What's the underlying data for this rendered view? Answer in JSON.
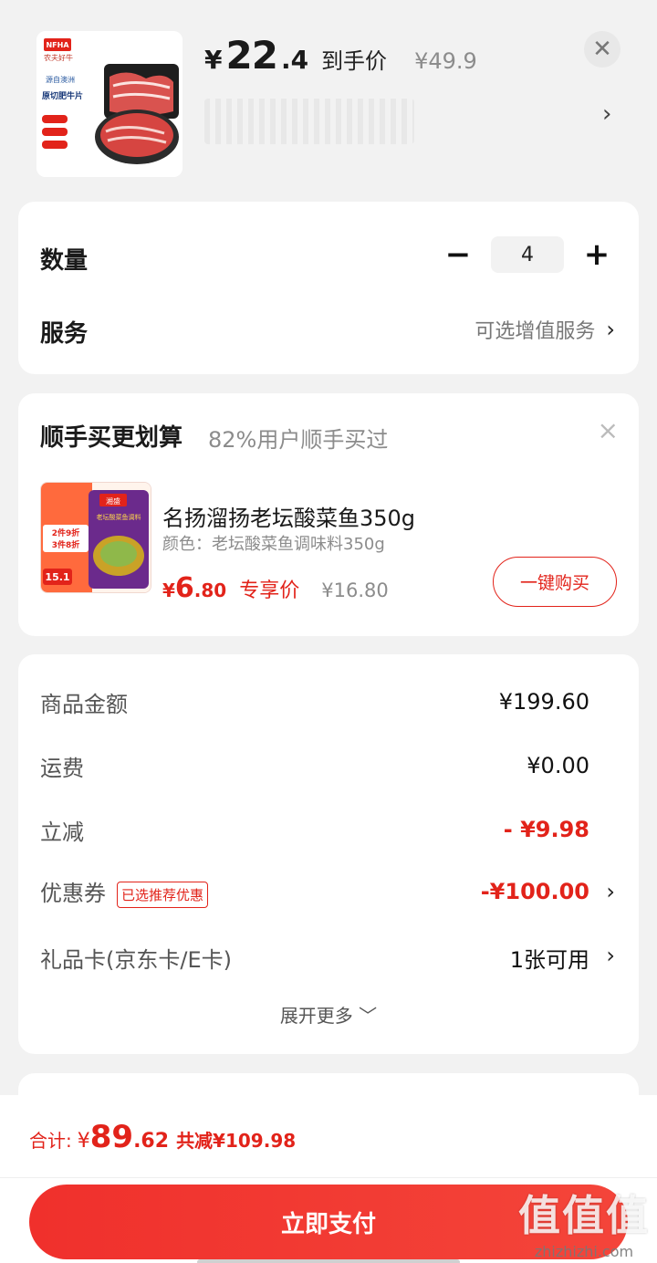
{
  "product": {
    "brand_logo_text": "NFHA",
    "brand_name": "农夫好牛",
    "badge_origin": "源自澳洲",
    "badge_title": "原切肥牛片",
    "price_currency": "¥",
    "price_integer": "22",
    "price_decimal": ".4",
    "price_label": "到手价",
    "original_price": "¥49.9",
    "close_icon": "close-icon",
    "spec_chevron": "›"
  },
  "quantity": {
    "label": "数量",
    "minus": "−",
    "value": "4",
    "plus": "+"
  },
  "service": {
    "label": "服务",
    "value": "可选增值服务",
    "chevron": "›"
  },
  "addon": {
    "title": "顺手买更划算",
    "subtitle": "82%用户顺手买过",
    "close": "×",
    "promo_line1": "2件9折",
    "promo_line2": "3件8折",
    "promo_price": "15.1",
    "package_brand": "湘盛",
    "package_name": "老坛酸菜鱼调料",
    "name": "名扬溜扬老坛酸菜鱼350g",
    "spec": "颜色：老坛酸菜鱼调味料350g",
    "price_currency": "¥",
    "price_integer": "6",
    "price_decimal": ".80",
    "price_tag": "专享价",
    "original_price": "¥16.80",
    "buy_label": "一键购买"
  },
  "fees": {
    "goods_label": "商品金额",
    "goods_value": "¥199.60",
    "shipping_label": "运费",
    "shipping_value": "¥0.00",
    "discount_label": "立减",
    "discount_value": "- ¥9.98",
    "coupon_label": "优惠券",
    "coupon_tag": "已选推荐优惠",
    "coupon_value": "-¥100.00",
    "giftcard_label": "礼品卡(京东卡/E卡)",
    "giftcard_value": "1张可用",
    "expand_label": "展开更多 ﹀"
  },
  "footer": {
    "total_label": "合计:",
    "total_currency": "¥",
    "total_integer": "89",
    "total_decimal": ".62",
    "total_saving": "共减¥109.98",
    "pay_label": "立即支付"
  },
  "watermark": {
    "main": "值值值",
    "sub": "zhizhizhi.com"
  },
  "colors": {
    "accent": "#e2231a",
    "background": "#f2f2f2"
  }
}
